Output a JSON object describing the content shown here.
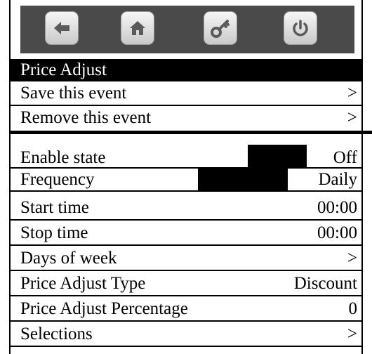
{
  "toolbar": {
    "buttons": [
      {
        "icon": "back-arrow-icon"
      },
      {
        "icon": "home-icon"
      },
      {
        "icon": "key-icon"
      },
      {
        "icon": "power-icon"
      }
    ]
  },
  "title": "Price Adjust",
  "actions": [
    {
      "label": "Save this event",
      "value": ">"
    },
    {
      "label": "Remove this event",
      "value": ">"
    }
  ],
  "settings": [
    {
      "label": "Enable state",
      "value": "Off"
    },
    {
      "label": "Frequency",
      "value": "Daily"
    },
    {
      "label": "Start time",
      "value": "00:00"
    },
    {
      "label": "Stop time",
      "value": "00:00"
    },
    {
      "label": "Days of week",
      "value": ">"
    },
    {
      "label": "Price Adjust Type",
      "value": "Discount"
    },
    {
      "label": "Price Adjust Percentage",
      "value": "0"
    },
    {
      "label": "Selections",
      "value": ">"
    }
  ]
}
